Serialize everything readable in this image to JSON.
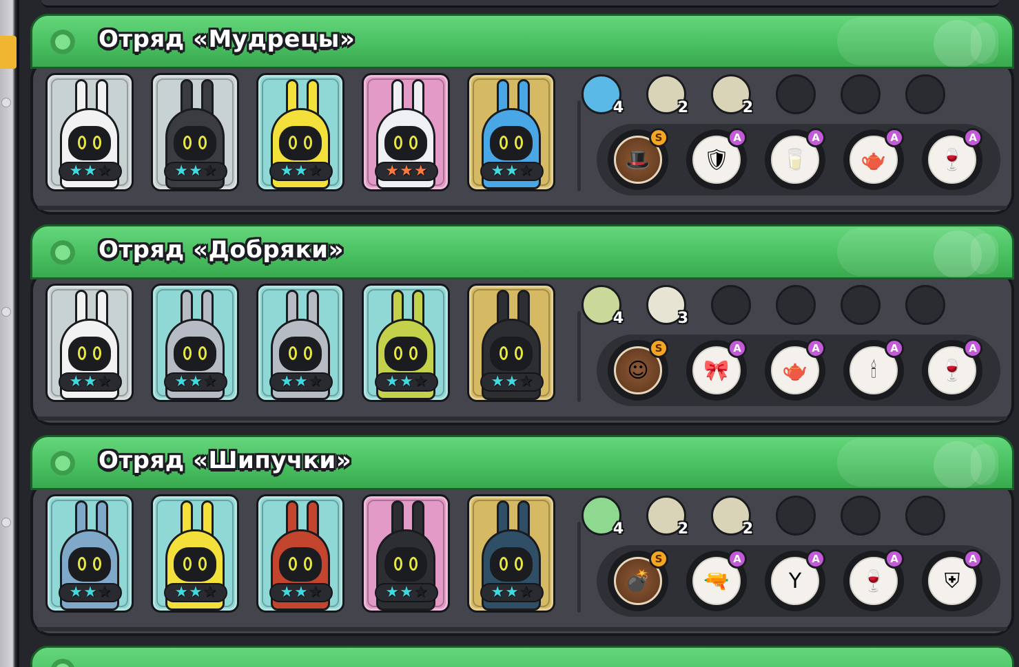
{
  "colors": {
    "header_green": "#4cc364",
    "panel": "#44454c",
    "star_cyan": "#3fd9e0",
    "star_orange": "#ff7a3c",
    "star_empty": "#1e1f24",
    "rank_s": "#f5a623",
    "rank_a": "#c45ad9"
  },
  "squads": [
    {
      "title": "Отряд «Мудрецы»",
      "heroes": [
        {
          "icon": "rabbit-glasses-hero",
          "card_color": "#c8d2d2",
          "body_color": "#f2f2f2",
          "stars": 2,
          "max_stars": 3,
          "star_color": "#3fd9e0"
        },
        {
          "icon": "hardhat-hero",
          "card_color": "#c8d2d2",
          "body_color": "#3b3c40",
          "stars": 2,
          "max_stars": 3,
          "star_color": "#3fd9e0"
        },
        {
          "icon": "diver-helmet-hero",
          "card_color": "#8fd8d6",
          "body_color": "#f3e03a",
          "stars": 2,
          "max_stars": 3,
          "star_color": "#3fd9e0"
        },
        {
          "icon": "propeller-robot-hero",
          "card_color": "#e39ac6",
          "body_color": "#eff0f3",
          "stars": 3,
          "max_stars": 3,
          "star_color": "#ff7a3c"
        },
        {
          "icon": "blue-dome-hero",
          "card_color": "#d6ba63",
          "body_color": "#4aa7e6",
          "stars": 2,
          "max_stars": 3,
          "star_color": "#3fd9e0"
        }
      ],
      "traits": [
        {
          "icon": "wizard-hat-icon",
          "count": "4",
          "bg": "#5ab9e6"
        },
        {
          "icon": "sword-icon",
          "count": "2",
          "bg": "#d9d4b8"
        },
        {
          "icon": "target-icon",
          "count": "2",
          "bg": "#d9d4b8"
        }
      ],
      "empty_traits": 3,
      "items": [
        {
          "icon": "wizard-hat-item-icon",
          "glyph": "🎩",
          "rank": "S",
          "special": true
        },
        {
          "icon": "blue-armor-item-icon",
          "glyph": "🛡",
          "rank": "A",
          "special": false
        },
        {
          "icon": "milk-carton-item-icon",
          "glyph": "🥛",
          "rank": "A",
          "special": false
        },
        {
          "icon": "teapot-item-icon",
          "glyph": "🫖",
          "rank": "A",
          "special": false
        },
        {
          "icon": "wine-glass-item-icon",
          "glyph": "🍷",
          "rank": "A",
          "special": false
        }
      ]
    },
    {
      "title": "Отряд «Добряки»",
      "heroes": [
        {
          "icon": "red-ear-rabbit-hero",
          "card_color": "#c8d2d2",
          "body_color": "#f2f2f2",
          "stars": 2,
          "max_stars": 3,
          "star_color": "#3fd9e0"
        },
        {
          "icon": "knight-helmet-hero",
          "card_color": "#8fd8d6",
          "body_color": "#b7bcc4",
          "stars": 2,
          "max_stars": 3,
          "star_color": "#3fd9e0"
        },
        {
          "icon": "magnet-hero",
          "card_color": "#8fd8d6",
          "body_color": "#b7bcc4",
          "stars": 2,
          "max_stars": 3,
          "star_color": "#3fd9e0"
        },
        {
          "icon": "sprout-hero",
          "card_color": "#8fd8d6",
          "body_color": "#c3d24a",
          "stars": 2,
          "max_stars": 3,
          "star_color": "#3fd9e0"
        },
        {
          "icon": "tuxedo-rabbit-hero",
          "card_color": "#d6ba63",
          "body_color": "#2d2e32",
          "stars": 2,
          "max_stars": 3,
          "star_color": "#3fd9e0"
        }
      ],
      "traits": [
        {
          "icon": "smile-face-icon",
          "count": "4",
          "bg": "#c9d99a"
        },
        {
          "icon": "muscle-arm-icon",
          "count": "3",
          "bg": "#e8e4d4"
        }
      ],
      "empty_traits": 4,
      "items": [
        {
          "icon": "smile-face-item-icon",
          "glyph": "☺",
          "rank": "S",
          "special": true
        },
        {
          "icon": "bow-tie-item-icon",
          "glyph": "🎀",
          "rank": "A",
          "special": false
        },
        {
          "icon": "teapot-item-icon",
          "glyph": "🫖",
          "rank": "A",
          "special": false
        },
        {
          "icon": "candle-item-icon",
          "glyph": "🕯",
          "rank": "A",
          "special": false
        },
        {
          "icon": "wine-glass-item-icon",
          "glyph": "🍷",
          "rank": "A",
          "special": false
        }
      ]
    },
    {
      "title": "Отряд «Шипучки»",
      "heroes": [
        {
          "icon": "shark-hero",
          "card_color": "#8fd8d6",
          "body_color": "#7fa8c9",
          "stars": 2,
          "max_stars": 3,
          "star_color": "#3fd9e0"
        },
        {
          "icon": "diver-helmet-hero",
          "card_color": "#8fd8d6",
          "body_color": "#f3e03a",
          "stars": 2,
          "max_stars": 3,
          "star_color": "#3fd9e0"
        },
        {
          "icon": "pig-punk-hero",
          "card_color": "#8fd8d6",
          "body_color": "#c4452e",
          "stars": 2,
          "max_stars": 3,
          "star_color": "#3fd9e0"
        },
        {
          "icon": "samurai-rabbit-hero",
          "card_color": "#e39ac6",
          "body_color": "#2d2e32",
          "stars": 2,
          "max_stars": 3,
          "star_color": "#3fd9e0"
        },
        {
          "icon": "police-rabbit-hero",
          "card_color": "#d6ba63",
          "body_color": "#2f4f66",
          "stars": 2,
          "max_stars": 3,
          "star_color": "#3fd9e0"
        }
      ],
      "traits": [
        {
          "icon": "bomb-icon",
          "count": "4",
          "bg": "#8fd88f"
        },
        {
          "icon": "sword-icon",
          "count": "2",
          "bg": "#d9d4b8"
        },
        {
          "icon": "magic-hat-icon",
          "count": "2",
          "bg": "#d9d4b8"
        }
      ],
      "empty_traits": 3,
      "items": [
        {
          "icon": "bomb-item-icon",
          "glyph": "💣",
          "rank": "S",
          "special": true
        },
        {
          "icon": "water-gun-item-icon",
          "glyph": "🔫",
          "rank": "A",
          "special": false
        },
        {
          "icon": "slingshot-item-icon",
          "glyph": "Y",
          "rank": "A",
          "special": false
        },
        {
          "icon": "wine-glass-item-icon",
          "glyph": "🍷",
          "rank": "A",
          "special": false
        },
        {
          "icon": "blue-shield-item-icon",
          "glyph": "⛨",
          "rank": "A",
          "special": false
        }
      ]
    }
  ]
}
